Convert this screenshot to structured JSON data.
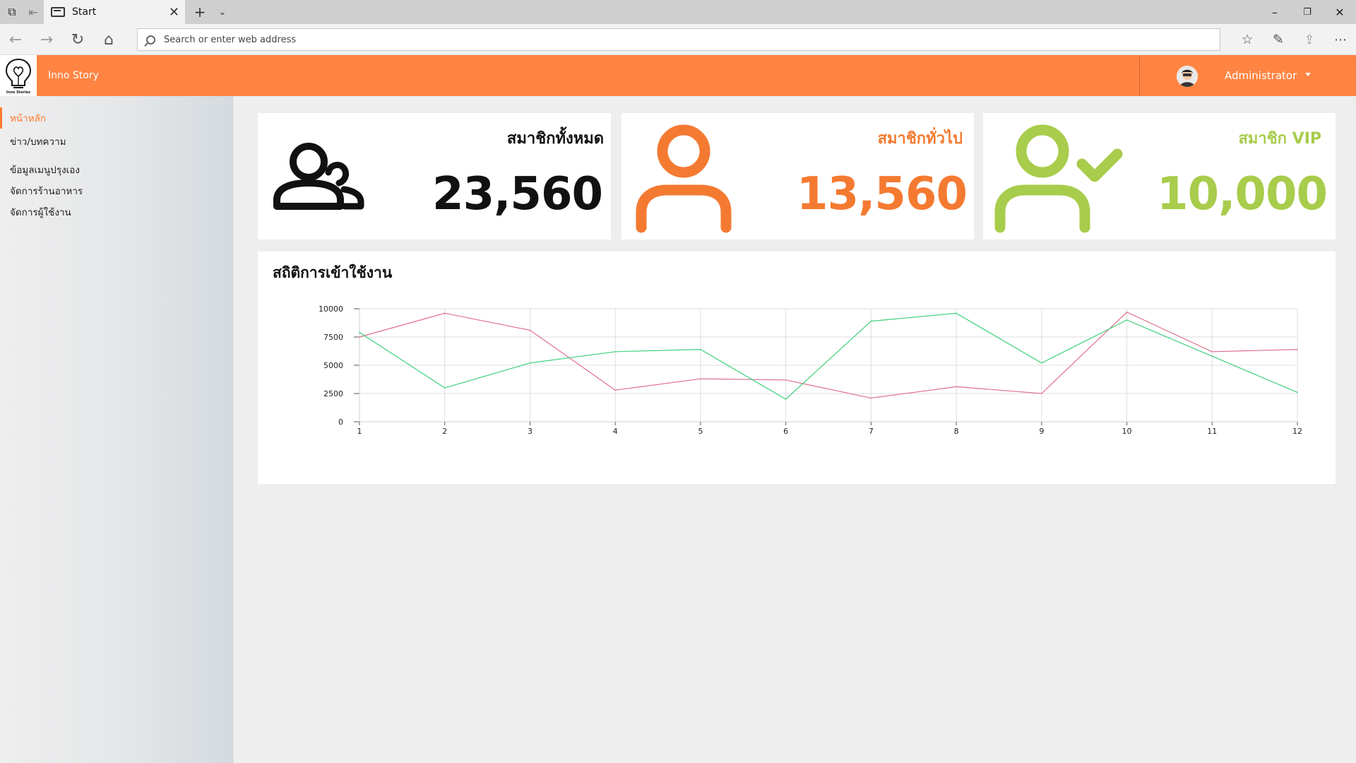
{
  "browser": {
    "tab_title": "Start",
    "address_placeholder": "Search or enter web address"
  },
  "app": {
    "brand": "Inno Story",
    "logo_text": "Inno Stories",
    "user": "Administrator"
  },
  "sidebar": {
    "items": [
      {
        "label": "หน้าหลัก",
        "active": true
      },
      {
        "label": "ข่าว/บทความ"
      },
      {
        "label": "ข้อมูลเมนูปรุงเอง"
      },
      {
        "label": "จัดการร้านอาหาร"
      },
      {
        "label": "จัดการผู้ใช้งาน"
      }
    ]
  },
  "stats": [
    {
      "title": "สมาชิกทั้งหมด",
      "value": "23,560",
      "color": "#111111",
      "icon": "users-icon"
    },
    {
      "title": "สมาชิกทั่วไป",
      "value": "13,560",
      "color": "#f47a31",
      "icon": "user-icon"
    },
    {
      "title": "สมาชิก VIP",
      "value": "10,000",
      "color": "#a8cc4b",
      "icon": "user-check-icon"
    }
  ],
  "chart_panel": {
    "title": "สถิติการเข้าใช้งาน"
  },
  "chart_data": {
    "type": "line",
    "x": [
      1,
      2,
      3,
      4,
      5,
      6,
      7,
      8,
      9,
      10,
      11,
      12
    ],
    "ylim": [
      0,
      10000
    ],
    "yticks": [
      "0",
      "2500",
      "5000",
      "7500",
      "10000"
    ],
    "grid": true,
    "series": [
      {
        "color": "#e0708a",
        "values": [
          7500,
          9600,
          8100,
          2800,
          3800,
          3700,
          2100,
          3100,
          2500,
          9700,
          6200,
          6400
        ]
      },
      {
        "color": "#3dd07a",
        "values": [
          7900,
          3000,
          5200,
          6200,
          6400,
          2000,
          8900,
          9600,
          5200,
          9000,
          5800,
          2600
        ]
      }
    ]
  }
}
